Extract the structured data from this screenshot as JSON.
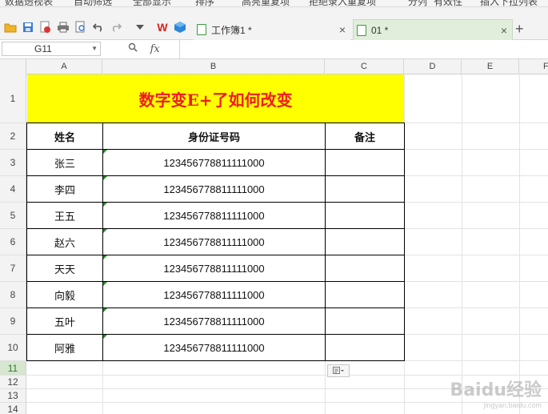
{
  "ribbon": {
    "items": [
      "数据透视表",
      "自动筛选",
      "全部显示",
      "排序",
      "高亮重复项",
      "拒绝录入重复项",
      "分列",
      "有效性",
      "插入下拉列表"
    ]
  },
  "toolbar": {
    "wps_logo": "W",
    "tabs": [
      {
        "label": "工作簿1 *",
        "close": "×"
      },
      {
        "label": "01 *",
        "close": "×"
      }
    ],
    "new_tab": "+"
  },
  "formula_bar": {
    "cell_ref": "G11",
    "fx_label": "fx"
  },
  "columns": [
    "A",
    "B",
    "C",
    "D",
    "E",
    "F"
  ],
  "rows": [
    "1",
    "2",
    "3",
    "4",
    "5",
    "6",
    "7",
    "8",
    "9",
    "10",
    "11",
    "12",
    "13",
    "14"
  ],
  "sheet": {
    "title": "数字变E+了如何改变",
    "headers": [
      "姓名",
      "身份证号码",
      "备注"
    ],
    "data_rows": [
      {
        "name": "张三",
        "id": "123456778811111000",
        "note": ""
      },
      {
        "name": "李四",
        "id": "123456778811111000",
        "note": ""
      },
      {
        "name": "王五",
        "id": "123456778811111000",
        "note": ""
      },
      {
        "name": "赵六",
        "id": "123456778811111000",
        "note": ""
      },
      {
        "name": "天天",
        "id": "123456778811111000",
        "note": ""
      },
      {
        "name": "向毅",
        "id": "123456778811111000",
        "note": ""
      },
      {
        "name": "五叶",
        "id": "123456778811111000",
        "note": ""
      },
      {
        "name": "阿雅",
        "id": "123456778811111000",
        "note": ""
      }
    ]
  },
  "colors": {
    "title_bg": "#ffff00",
    "title_text": "#ee1c25",
    "active_tab": "#e1eedb",
    "error_marker": "#1e8f1e"
  },
  "watermark": {
    "main": "Baidu经验",
    "sub": "jingyan.baidu.com"
  }
}
